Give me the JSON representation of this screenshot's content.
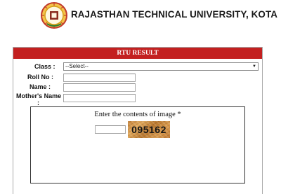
{
  "header": {
    "university_name": "RAJASTHAN TECHNICAL UNIVERSITY, KOTA",
    "logo_icon": "university-emblem-icon"
  },
  "form": {
    "title": "RTU RESULT",
    "header_color": "#c32020",
    "class_label": "Class :",
    "class_selected": "--Select--",
    "roll_label": "Roll No :",
    "roll_value": "",
    "name_label": "Name :",
    "name_value": "",
    "mother_label_line1": "Mother's Name",
    "mother_label_line2": ":",
    "mother_value": ""
  },
  "captcha": {
    "prompt": "Enter the contents of image *",
    "input_value": "",
    "image_text": "095162"
  }
}
